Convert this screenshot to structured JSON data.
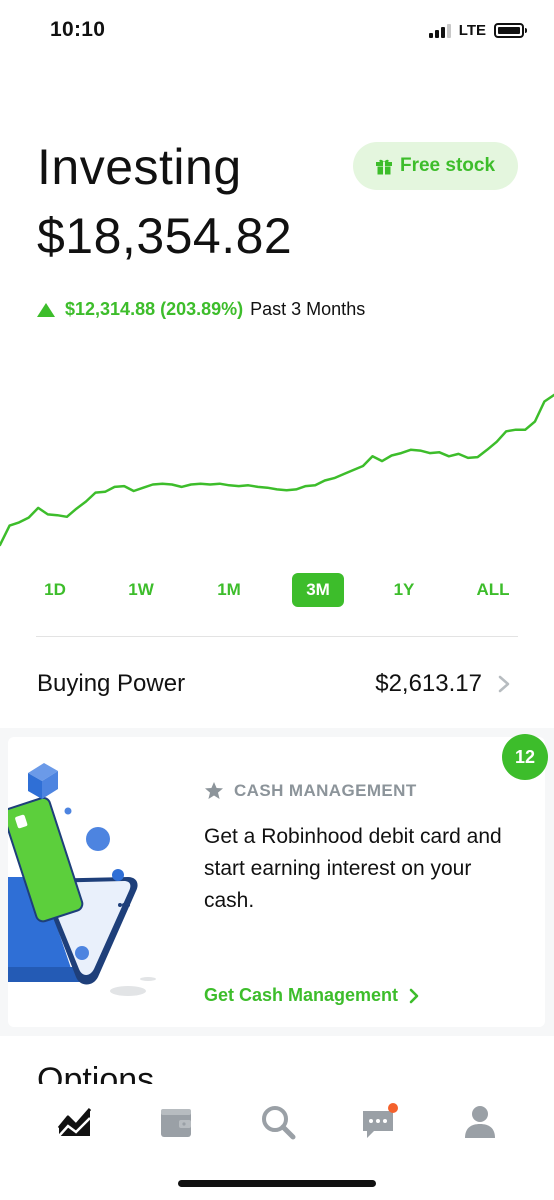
{
  "status_bar": {
    "time": "10:10",
    "network": "LTE"
  },
  "header": {
    "title": "Investing",
    "portfolio_value": "$18,354.82",
    "free_stock_label": "Free stock",
    "change_amount": "$12,314.88 (203.89%)",
    "change_period": "Past 3 Months"
  },
  "colors": {
    "accent": "#3dbd2b",
    "accent_light": "#e4f6de",
    "muted": "#8c949a",
    "section_bg": "#f6f7f8"
  },
  "chart_data": {
    "type": "line",
    "series": [
      {
        "values": [
          12.0,
          14.4,
          14.8,
          15.4,
          16.6,
          15.8,
          15.7,
          15.5,
          16.5,
          17.4,
          18.5,
          18.6,
          19.2,
          19.3,
          18.7,
          19.1,
          19.5,
          19.6,
          19.5,
          19.2,
          19.5,
          19.6,
          19.5,
          19.6,
          19.4,
          19.3,
          19.4,
          19.2,
          19.1,
          18.9,
          18.8,
          18.9,
          19.3,
          19.4,
          20.0,
          20.3,
          20.8,
          21.3,
          21.8,
          23.0,
          22.4,
          23.1,
          23.4,
          23.8,
          23.7,
          23.4,
          23.5,
          23.0,
          23.3,
          22.8,
          22.9,
          23.8,
          24.8,
          26.1,
          26.3,
          26.3,
          27.3,
          29.8,
          30.6
        ]
      }
    ],
    "grid": false,
    "legend": "none"
  },
  "range_tabs": [
    {
      "label": "1D",
      "active": false
    },
    {
      "label": "1W",
      "active": false
    },
    {
      "label": "1M",
      "active": false
    },
    {
      "label": "3M",
      "active": true
    },
    {
      "label": "1Y",
      "active": false
    },
    {
      "label": "ALL",
      "active": false
    }
  ],
  "buying_power": {
    "label": "Buying Power",
    "value": "$2,613.17"
  },
  "promo_card": {
    "eyebrow": "CASH MANAGEMENT",
    "body": "Get a Robinhood debit card and start earning interest on your cash.",
    "cta": "Get Cash Management",
    "badge_count": "12"
  },
  "options_heading": "Options",
  "bottom_nav": [
    {
      "name": "home",
      "icon": "chart-icon",
      "active": true
    },
    {
      "name": "cash",
      "icon": "wallet-icon",
      "active": false
    },
    {
      "name": "search",
      "icon": "search-icon",
      "active": false
    },
    {
      "name": "messages",
      "icon": "chat-icon",
      "active": false,
      "has_notification": true
    },
    {
      "name": "account",
      "icon": "person-icon",
      "active": false
    }
  ]
}
